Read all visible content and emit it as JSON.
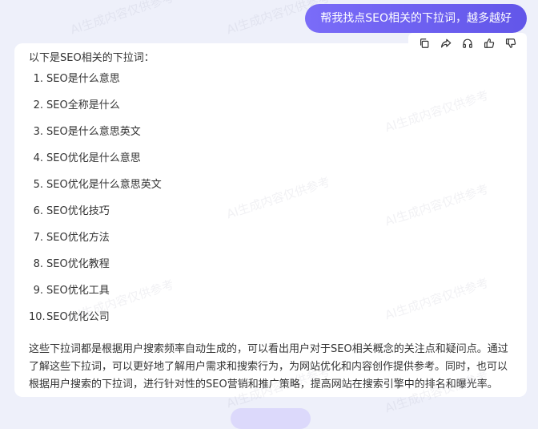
{
  "user_message": "帮我找点SEO相关的下拉词，越多越好",
  "actions": {
    "icons": [
      "copy-icon",
      "share-icon",
      "headphones-icon",
      "thumbs-up-icon",
      "thumbs-down-icon"
    ]
  },
  "answer": {
    "intro": "以下是SEO相关的下拉词：",
    "items": [
      {
        "num": "1.",
        "text": "SEO是什么意思"
      },
      {
        "num": "2.",
        "text": "SEO全称是什么"
      },
      {
        "num": "3.",
        "text": "SEO是什么意思英文"
      },
      {
        "num": "4.",
        "text": "SEO优化是什么意思"
      },
      {
        "num": "5.",
        "text": "SEO优化是什么意思英文"
      },
      {
        "num": "6.",
        "text": "SEO优化技巧"
      },
      {
        "num": "7.",
        "text": "SEO优化方法"
      },
      {
        "num": "8.",
        "text": "SEO优化教程"
      },
      {
        "num": "9.",
        "text": "SEO优化工具"
      },
      {
        "num": "10.",
        "text": "SEO优化公司"
      }
    ],
    "summary": "这些下拉词都是根据用户搜索频率自动生成的，可以看出用户对于SEO相关概念的关注点和疑问点。通过了解这些下拉词，可以更好地了解用户需求和搜索行为，为网站优化和内容创作提供参考。同时，也可以根据用户搜索的下拉词，进行针对性的SEO营销和推广策略，提高网站在搜索引擎中的排名和曝光率。"
  },
  "watermark": "AI生成内容仅供参考",
  "colors": {
    "accent": "#6b5ff2",
    "background": "#eef0fa"
  }
}
